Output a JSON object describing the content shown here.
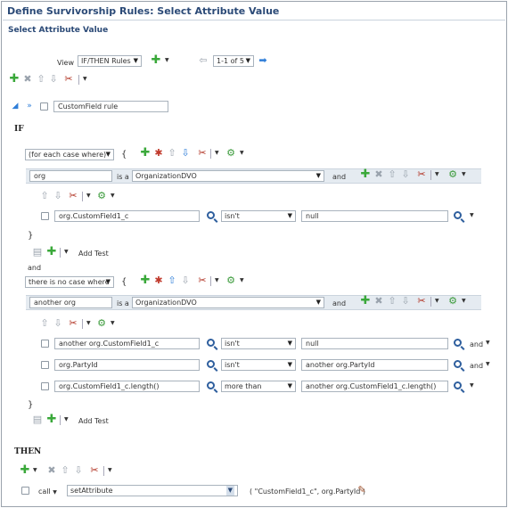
{
  "page": {
    "title": "Define Survivorship Rules: Select Attribute Value",
    "section": "Select Attribute Value"
  },
  "viewbar": {
    "view_label": "View",
    "view_value": "IF/THEN Rules",
    "pager": "1-1 of 5"
  },
  "rule": {
    "name_value": "CustomField rule"
  },
  "if_section": {
    "label": "IF",
    "case1": {
      "case_select": "(for each case where)",
      "open_brace": "{",
      "object_name": "org",
      "is_a": "is a",
      "type": "OrganizationDVO",
      "and": "and",
      "tests": [
        {
          "attr": "org.CustomField1_c",
          "op": "isn't",
          "value": "null",
          "suffix": ""
        }
      ],
      "close_brace": "}",
      "add_test": "Add Test"
    },
    "join": "and",
    "case2": {
      "case_select": "there is no case where",
      "open_brace": "{",
      "object_name": "another org",
      "is_a": "is a",
      "type": "OrganizationDVO",
      "and": "and",
      "tests": [
        {
          "attr": "another org.CustomField1_c",
          "op": "isn't",
          "value": "null",
          "suffix": "and"
        },
        {
          "attr": "org.PartyId",
          "op": "isn't",
          "value": "another org.PartyId",
          "suffix": "and"
        },
        {
          "attr": "org.CustomField1_c.length()",
          "op": "more than",
          "value": "another org.CustomField1_c.length()",
          "suffix": ""
        }
      ],
      "close_brace": "}",
      "add_test": "Add Test"
    }
  },
  "then_section": {
    "label": "THEN",
    "call_label": "call",
    "action_value": "setAttribute",
    "args": "( \"CustomField1_c\", org.PartyId )"
  }
}
